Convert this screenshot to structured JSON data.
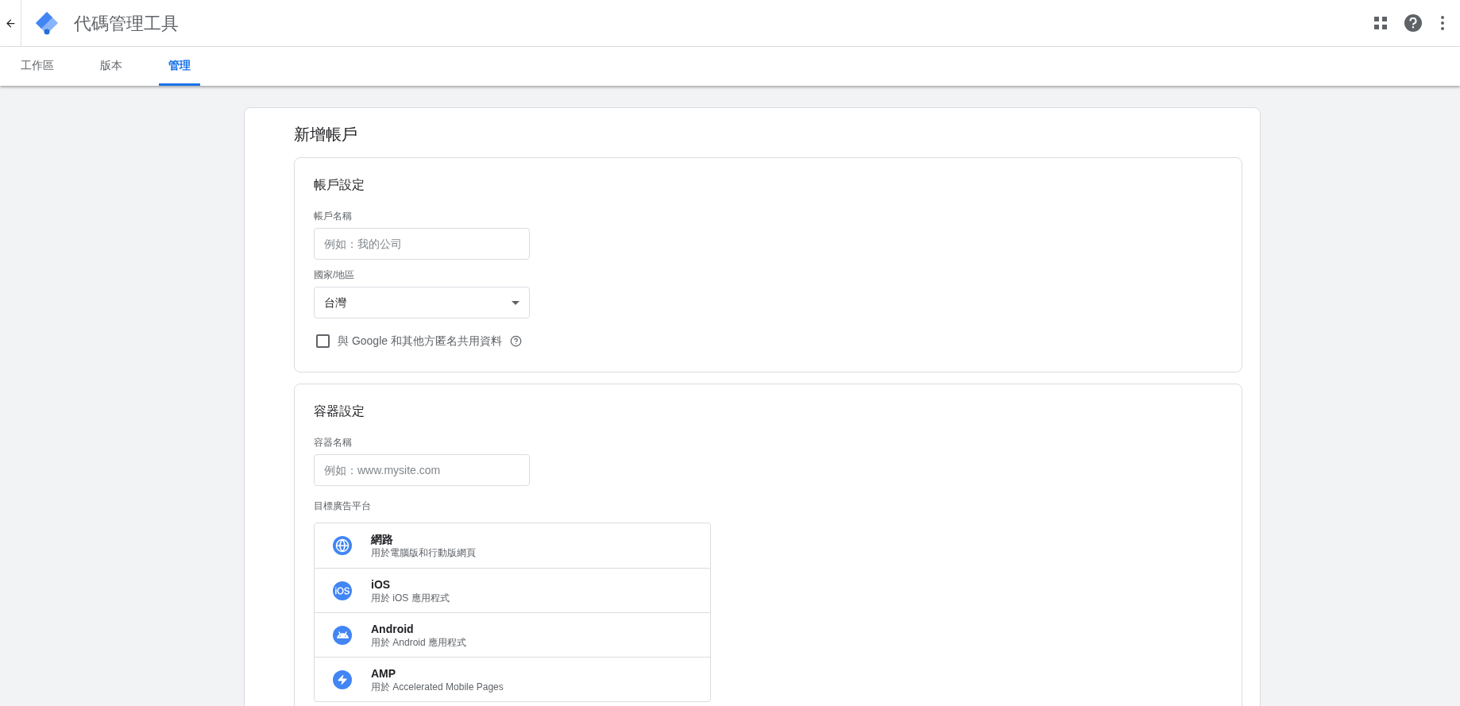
{
  "header": {
    "title": "代碼管理工具"
  },
  "tabs": [
    {
      "label": "工作區",
      "selected": false
    },
    {
      "label": "版本",
      "selected": false
    },
    {
      "label": "管理",
      "selected": true
    }
  ],
  "page_title": "新增帳戶",
  "account_settings": {
    "heading": "帳戶設定",
    "name_label": "帳戶名稱",
    "name_placeholder": "例如：我的公司",
    "country_label": "國家/地區",
    "country_value": "台灣",
    "share_checkbox": {
      "label": "與 Google 和其他方匿名共用資料",
      "checked": false
    }
  },
  "container_settings": {
    "heading": "容器設定",
    "name_label": "容器名稱",
    "name_placeholder": "例如：www.mysite.com",
    "platform_label": "目標廣告平台",
    "platforms": [
      {
        "kind": "web",
        "name": "網路",
        "description": "用於電腦版和行動版網頁"
      },
      {
        "kind": "ios",
        "name": "iOS",
        "description": "用於 iOS 應用程式"
      },
      {
        "kind": "android",
        "name": "Android",
        "description": "用於 Android 應用程式"
      },
      {
        "kind": "amp",
        "name": "AMP",
        "description": "用於 Accelerated Mobile Pages"
      }
    ]
  }
}
